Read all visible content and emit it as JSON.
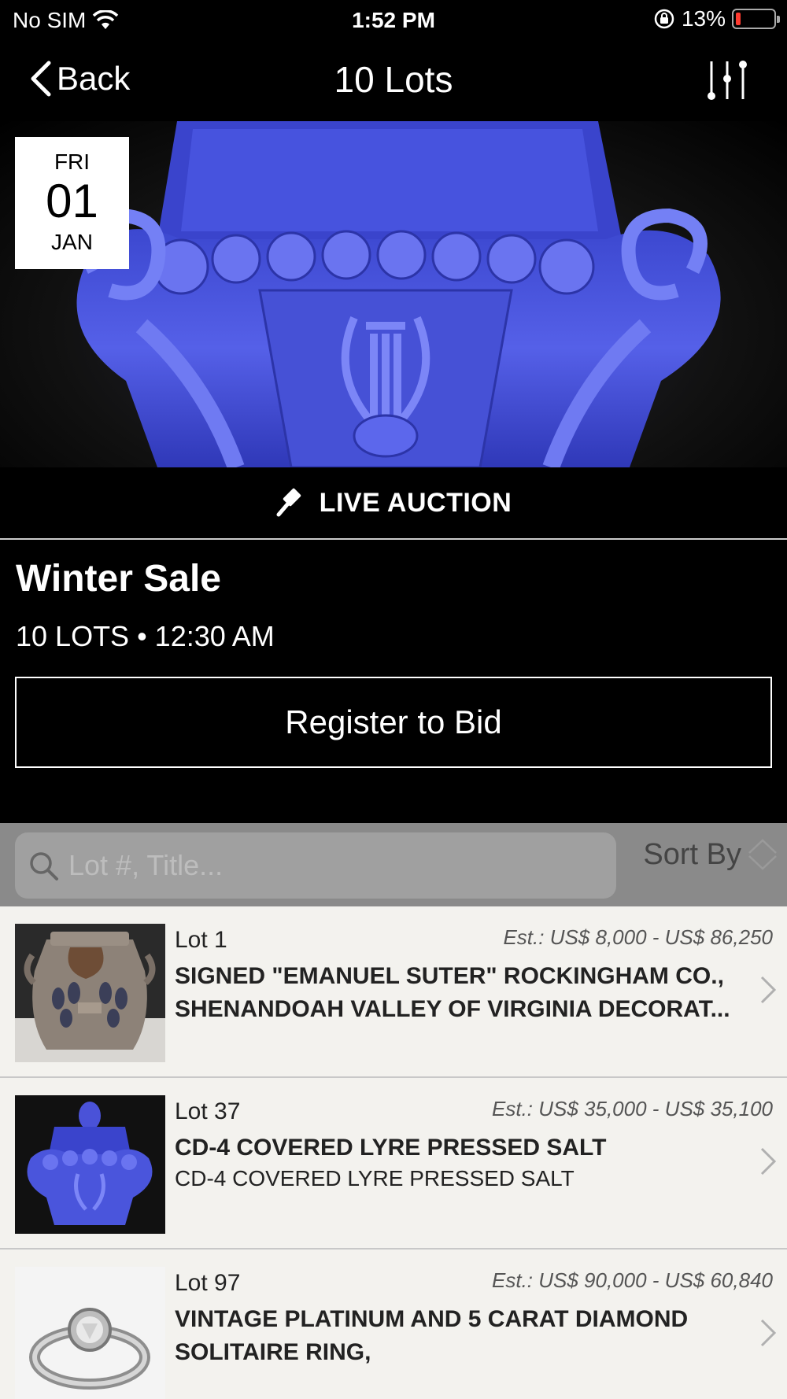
{
  "status_bar": {
    "carrier": "No SIM",
    "time": "1:52 PM",
    "battery_percent": "13%",
    "battery_level": 0.13,
    "battery_color": "#ff3b30"
  },
  "nav": {
    "back_label": "Back",
    "title": "10 Lots",
    "filter_icon": "sliders-icon"
  },
  "hero": {
    "image": "blue-glass-lyre-salt-photo",
    "date": {
      "weekday": "FRI",
      "day": "01",
      "month": "JAN"
    }
  },
  "auction_type": {
    "icon": "gavel-icon",
    "label": "LIVE AUCTION"
  },
  "sale": {
    "title": "Winter Sale",
    "meta": "10 LOTS • 12:30 AM",
    "register_label": "Register to Bid"
  },
  "search": {
    "placeholder": "Lot #, Title...",
    "sort_label": "Sort By"
  },
  "lots": [
    {
      "lot_label": "Lot 1",
      "estimate": "Est.: US$ 8,000 - US$ 86,250",
      "title": "SIGNED \"EMANUEL SUTER\" ROCKINGHAM CO., SHENANDOAH VALLEY OF VIRGINIA DECORAT...",
      "description": "",
      "thumbnail": "stoneware-jar-photo"
    },
    {
      "lot_label": "Lot 37",
      "estimate": "Est.: US$ 35,000 - US$ 35,100",
      "title": "CD-4 COVERED LYRE PRESSED SALT",
      "description": "CD-4 COVERED LYRE PRESSED SALT",
      "thumbnail": "blue-glass-salt-photo"
    },
    {
      "lot_label": "Lot 97",
      "estimate": "Est.: US$ 90,000 - US$ 60,840",
      "title": "VINTAGE PLATINUM AND 5 CARAT DIAMOND SOLITAIRE RING,",
      "description": "",
      "thumbnail": "diamond-ring-photo"
    }
  ],
  "colors": {
    "background": "#000000",
    "list_background": "#f3f2ee",
    "search_bar": "#8a8a8a",
    "glass_blue": "#4a52d8"
  }
}
